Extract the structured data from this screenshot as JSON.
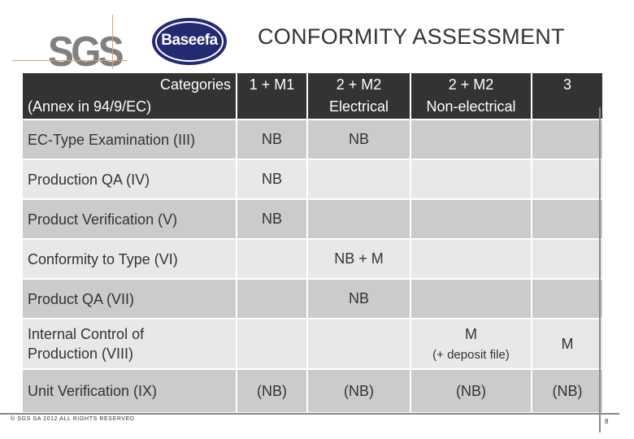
{
  "logos": {
    "sgs": "SGS",
    "baseefa": "Baseefa",
    "accent_orange": "#e0a060",
    "baseefa_navy": "#232a72"
  },
  "title": "CONFORMITY ASSESSMENT",
  "table": {
    "header": {
      "categories_line1": "Categories",
      "categories_line2": "(Annex in 94/9/EC)",
      "columns": [
        {
          "line1": "1 + M1",
          "line2": ""
        },
        {
          "line1": "2 + M2",
          "line2": "Electrical"
        },
        {
          "line1": "2 + M2",
          "line2": "Non-electrical"
        },
        {
          "line1": "3",
          "line2": ""
        }
      ]
    },
    "rows": [
      {
        "label": "EC-Type Examination (III)",
        "c1": "NB",
        "c2": "NB",
        "c3": "",
        "c4": ""
      },
      {
        "label": "Production QA (IV)",
        "c1": "NB",
        "c2": "",
        "c3": "",
        "c4": ""
      },
      {
        "label": "Product Verification (V)",
        "c1": "NB",
        "c2": "",
        "c3": "",
        "c4": ""
      },
      {
        "label": "Conformity to Type (VI)",
        "c1": "",
        "c2": "NB + M",
        "c3": "",
        "c4": ""
      },
      {
        "label": "Product QA (VII)",
        "c1": "",
        "c2": "NB",
        "c3": "",
        "c4": ""
      },
      {
        "label_line1": "Internal Control of",
        "label_line2": "Production (VIII)",
        "c1": "",
        "c2": "",
        "c3": "M",
        "c3_sub": "(+ deposit file)",
        "c4": "M"
      },
      {
        "label": "Unit Verification (IX)",
        "c1": "(NB)",
        "c2": "(NB)",
        "c3": "(NB)",
        "c4": "(NB)"
      }
    ]
  },
  "footer": {
    "copyright": "© SGS SA 2012 ALL RIGHTS RESERVED",
    "page_number": "8"
  }
}
